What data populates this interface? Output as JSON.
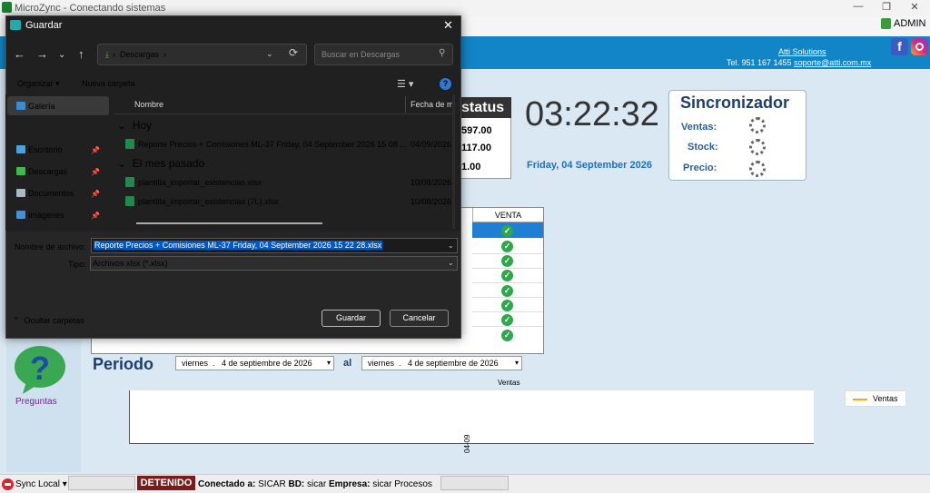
{
  "window": {
    "title": "MicroZync - Conectando sistemas",
    "user": "ADMIN"
  },
  "banner": {
    "company": "Atti Solutions",
    "phone": "Tel. 951 167 1455",
    "email": "soporte@atti.com.mx"
  },
  "status": {
    "title": "status",
    "values": [
      "597.00",
      "117.00",
      "1.00"
    ]
  },
  "clock": {
    "time": "03:22:32",
    "date": "Friday, 04 September 2026"
  },
  "sync": {
    "title": "Sincronizador",
    "labels": [
      "Ventas:",
      "Stock:",
      "Precio:"
    ]
  },
  "grid": {
    "header": "VENTA"
  },
  "periodo": {
    "label": "Periodo",
    "from_day": "viernes",
    "from_date": "4 de septiembre de 2026",
    "al": "al",
    "to_day": "viernes",
    "to_date": "4 de septiembre de 2026"
  },
  "chart": {
    "title": "Ventas",
    "legend": "Ventas",
    "x_tick": "04-09"
  },
  "left": {
    "preguntas": "Preguntas"
  },
  "statusbar": {
    "sync_local": "Sync Local",
    "detenido": "DETENIDO",
    "conectado_label": "Conectado a:",
    "conectado_value": "SICAR",
    "bd_label": "BD:",
    "bd_value": "sicar",
    "empresa_label": "Empresa:",
    "empresa_value": "sicar",
    "procesos": "Procesos"
  },
  "dialog": {
    "title": "Guardar",
    "address": "Descargas",
    "search_placeholder": "Buscar en Descargas",
    "organize": "Organizar",
    "new_folder": "Nueva carpeta",
    "nav": [
      {
        "label": "Galería"
      },
      {
        "label": "Escritorio"
      },
      {
        "label": "Descargas"
      },
      {
        "label": "Documentos"
      },
      {
        "label": "Imágenes"
      }
    ],
    "col_name": "Nombre",
    "col_date": "Fecha de m",
    "groups": [
      "Hoy",
      "El mes pasado"
    ],
    "files": [
      {
        "name": "Reporte Precios + Comisiones ML-37 Friday, 04 September 2026 15 08 ...",
        "date": "04/09/2026"
      },
      {
        "name": "plantilla_importar_existencias.xlsx",
        "date": "10/08/2026"
      },
      {
        "name": "plantilla_importar_existencias (7L).xlsx",
        "date": "10/08/2026"
      }
    ],
    "filename_label": "Nombre de archivo:",
    "filename": "Reporte Precios + Comisiones ML-37 Friday, 04 September 2026 15 22 28.xlsx",
    "type_label": "Tipo:",
    "type_value": "Archivos xlsx (*.xlsx)",
    "hide_folders": "Ocultar carpetas",
    "save": "Guardar",
    "cancel": "Cancelar"
  }
}
